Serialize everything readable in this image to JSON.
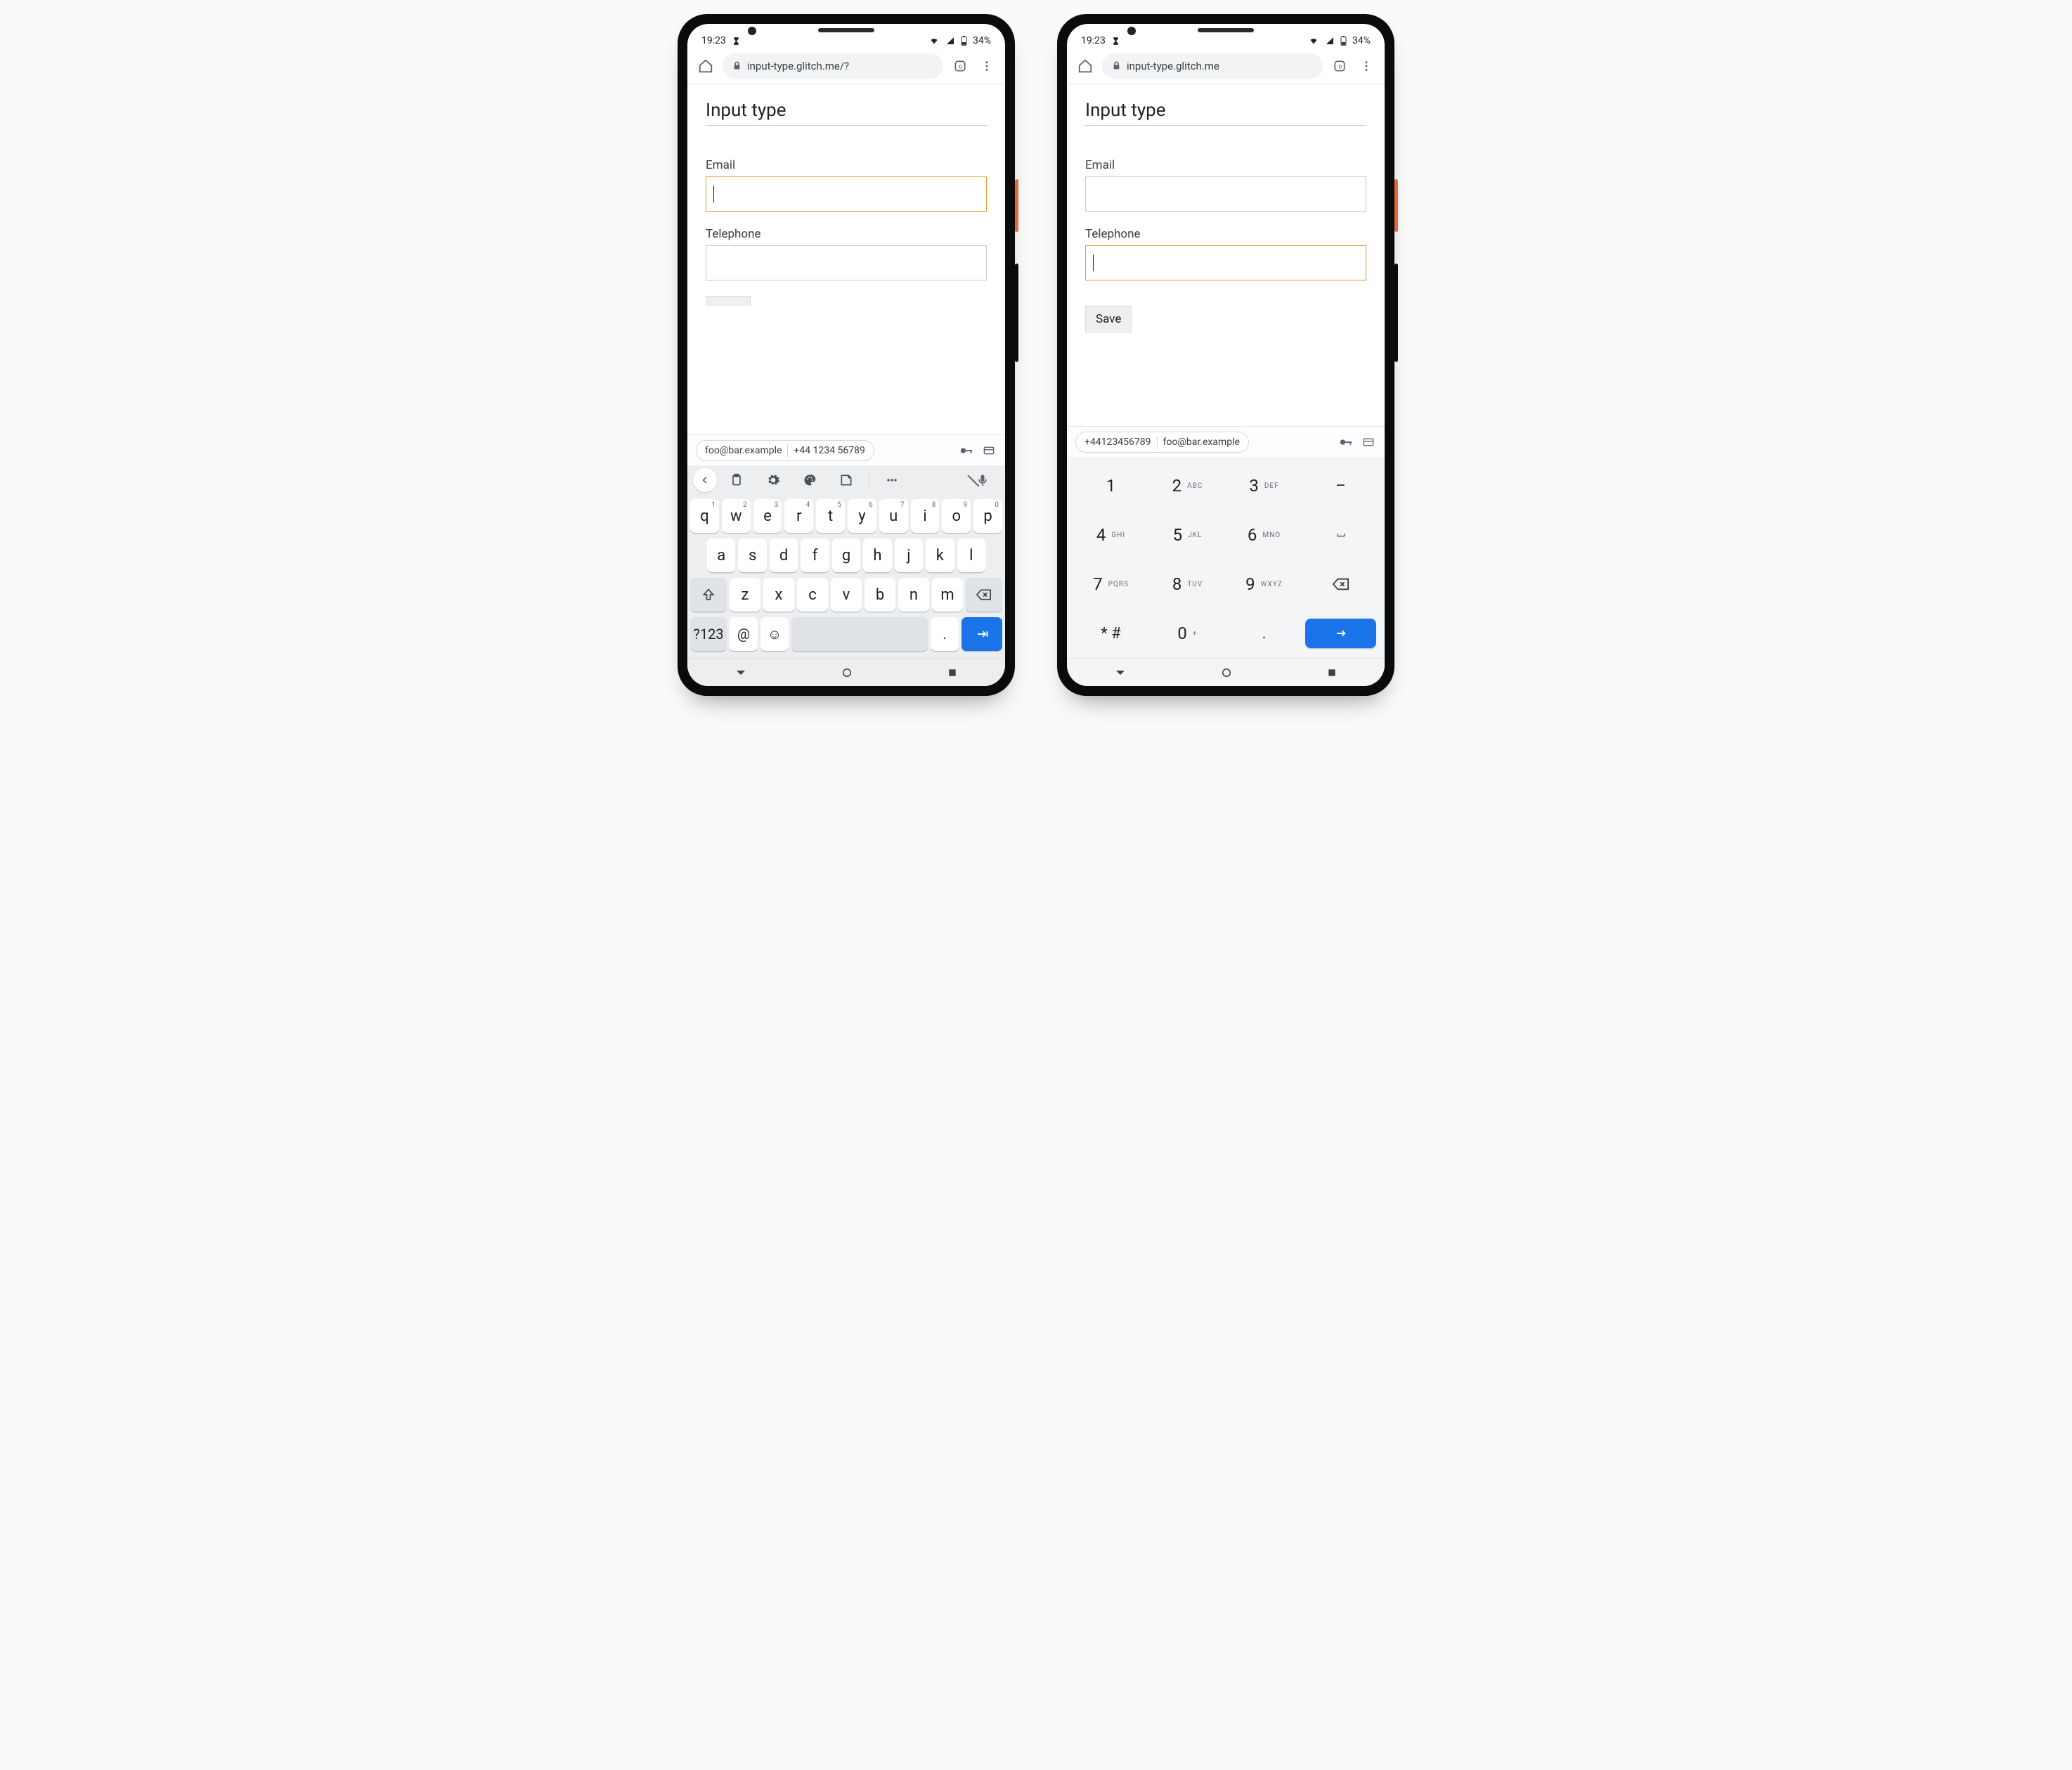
{
  "statusbar": {
    "time": "19:23",
    "battery": "34%"
  },
  "phones": [
    {
      "url": "input-type.glitch.me/?",
      "page": {
        "heading": "Input type",
        "email_label": "Email",
        "tel_label": "Telephone",
        "focused": "email",
        "show_save": false
      },
      "suggest": {
        "email": "foo@bar.example",
        "phone": "+44 1234 56789"
      },
      "keyboard": {
        "type": "qwerty",
        "row1": [
          {
            "c": "q",
            "n": "1"
          },
          {
            "c": "w",
            "n": "2"
          },
          {
            "c": "e",
            "n": "3"
          },
          {
            "c": "r",
            "n": "4"
          },
          {
            "c": "t",
            "n": "5"
          },
          {
            "c": "y",
            "n": "6"
          },
          {
            "c": "u",
            "n": "7"
          },
          {
            "c": "i",
            "n": "8"
          },
          {
            "c": "o",
            "n": "9"
          },
          {
            "c": "p",
            "n": "0"
          }
        ],
        "row2": [
          "a",
          "s",
          "d",
          "f",
          "g",
          "h",
          "j",
          "k",
          "l"
        ],
        "row3": [
          "z",
          "x",
          "c",
          "v",
          "b",
          "n",
          "m"
        ],
        "fn_label": "?123",
        "at_label": "@",
        "dot_label": "."
      }
    },
    {
      "url": "input-type.glitch.me",
      "page": {
        "heading": "Input type",
        "email_label": "Email",
        "tel_label": "Telephone",
        "focused": "tel",
        "show_save": true,
        "save_label": "Save"
      },
      "suggest": {
        "phone": "+44123456789",
        "email": "foo@bar.example"
      },
      "keyboard": {
        "type": "numpad",
        "keys": [
          {
            "n": "1",
            "s": ""
          },
          {
            "n": "2",
            "s": "ABC"
          },
          {
            "n": "3",
            "s": "DEF"
          },
          {
            "op": "–"
          },
          {
            "n": "4",
            "s": "GHI"
          },
          {
            "n": "5",
            "s": "JKL"
          },
          {
            "n": "6",
            "s": "MNO"
          },
          {
            "op": "␣"
          },
          {
            "n": "7",
            "s": "PQRS"
          },
          {
            "n": "8",
            "s": "TUV"
          },
          {
            "n": "9",
            "s": "WXYZ"
          },
          {
            "op": "bksp"
          },
          {
            "op": "* #"
          },
          {
            "n": "0",
            "s": "+"
          },
          {
            "op": "."
          },
          {
            "op": "enter"
          }
        ]
      }
    }
  ]
}
